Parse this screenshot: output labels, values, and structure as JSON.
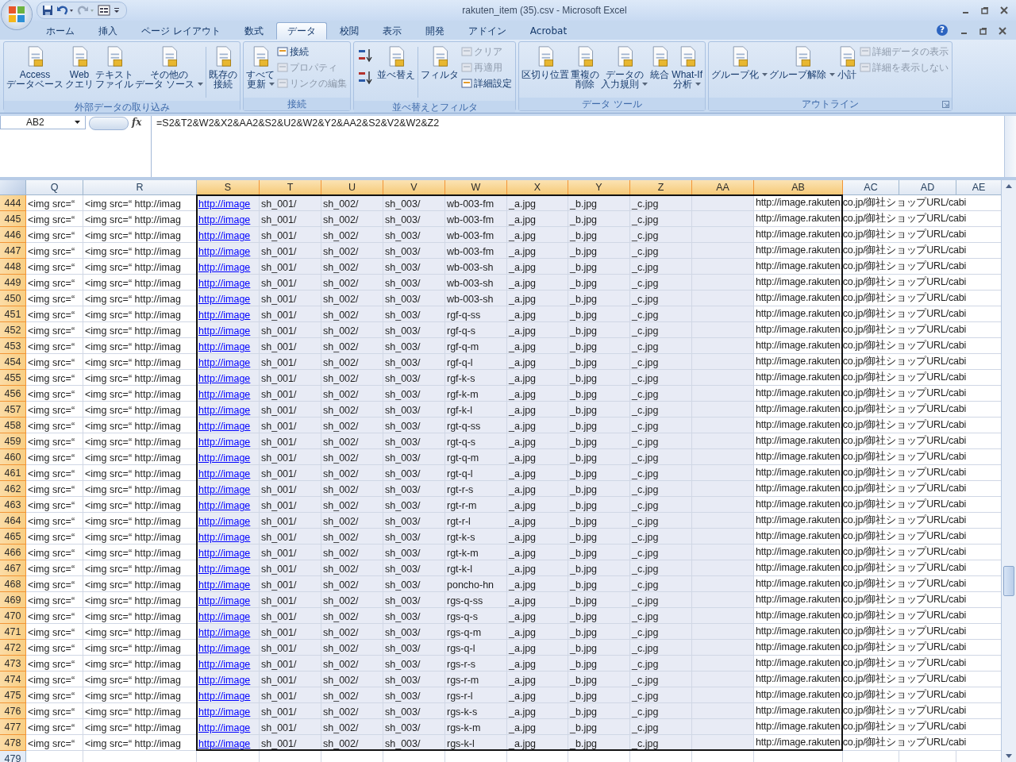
{
  "window": {
    "title": "rakuten_item (35).csv - Microsoft Excel"
  },
  "tabs": [
    {
      "label": "ホーム",
      "selected": false
    },
    {
      "label": "挿入",
      "selected": false
    },
    {
      "label": "ページ レイアウト",
      "selected": false
    },
    {
      "label": "数式",
      "selected": false
    },
    {
      "label": "データ",
      "selected": true
    },
    {
      "label": "校閲",
      "selected": false
    },
    {
      "label": "表示",
      "selected": false
    },
    {
      "label": "開発",
      "selected": false
    },
    {
      "label": "アドイン",
      "selected": false
    },
    {
      "label": "Acrobat",
      "selected": false
    }
  ],
  "help_label": "?",
  "ribbon": [
    {
      "items": [
        {
          "kind": "large",
          "lines": [
            "Access",
            "データベース"
          ],
          "dropdown": false
        },
        {
          "kind": "large",
          "lines": [
            "Web",
            "クエリ"
          ],
          "dropdown": false
        },
        {
          "kind": "large",
          "lines": [
            "テキスト",
            "ファイル"
          ],
          "dropdown": false
        },
        {
          "kind": "large",
          "lines": [
            "その他の",
            "データ ソース"
          ],
          "dropdown": true
        },
        {
          "kind": "separator"
        },
        {
          "kind": "large",
          "lines": [
            "既存の",
            "接続"
          ],
          "dropdown": false
        }
      ],
      "label": "外部データの取り込み",
      "launcher": false
    },
    {
      "items": [
        {
          "kind": "large",
          "lines": [
            "すべて",
            "更新"
          ],
          "dropdown": true
        },
        {
          "kind": "stack",
          "buttons": [
            {
              "label": "接続",
              "disabled": false
            },
            {
              "label": "プロパティ",
              "disabled": true
            },
            {
              "label": "リンクの編集",
              "disabled": true
            }
          ]
        }
      ],
      "label": "接続",
      "launcher": false
    },
    {
      "items": [
        {
          "kind": "sorts"
        },
        {
          "kind": "large",
          "lines": [
            "並べ替え"
          ],
          "dropdown": false
        },
        {
          "kind": "separator"
        },
        {
          "kind": "large",
          "lines": [
            "フィルタ"
          ],
          "dropdown": false
        },
        {
          "kind": "stack",
          "buttons": [
            {
              "label": "クリア",
              "disabled": true
            },
            {
              "label": "再適用",
              "disabled": true
            },
            {
              "label": "詳細設定",
              "disabled": false
            }
          ]
        }
      ],
      "label": "並べ替えとフィルタ",
      "launcher": false
    },
    {
      "items": [
        {
          "kind": "large",
          "lines": [
            "区切り位置"
          ],
          "dropdown": false
        },
        {
          "kind": "large",
          "lines": [
            "重複の",
            "削除"
          ],
          "dropdown": false
        },
        {
          "kind": "large",
          "lines": [
            "データの",
            "入力規則"
          ],
          "dropdown": true
        },
        {
          "kind": "large",
          "lines": [
            "統合"
          ],
          "dropdown": false
        },
        {
          "kind": "large",
          "lines": [
            "What-If",
            "分析"
          ],
          "dropdown": true
        }
      ],
      "label": "データ ツール",
      "launcher": false
    },
    {
      "items": [
        {
          "kind": "large",
          "lines": [
            "グループ化"
          ],
          "dropdown": true
        },
        {
          "kind": "large",
          "lines": [
            "グループ解除"
          ],
          "dropdown": true
        },
        {
          "kind": "large",
          "lines": [
            "小計"
          ],
          "dropdown": false
        },
        {
          "kind": "stack",
          "buttons": [
            {
              "label": "詳細データの表示",
              "disabled": true
            },
            {
              "label": "詳細を表示しない",
              "disabled": true
            }
          ]
        }
      ],
      "label": "アウトライン",
      "launcher": true
    }
  ],
  "name_box": "AB2",
  "function_label": "fx",
  "formula": "=S2&T2&W2&X2&AA2&S2&U2&W2&Y2&AA2&S2&V2&W2&Z2",
  "columns": [
    {
      "letter": "Q",
      "selected": false
    },
    {
      "letter": "R",
      "selected": false
    },
    {
      "letter": "S",
      "selected": true
    },
    {
      "letter": "T",
      "selected": true
    },
    {
      "letter": "U",
      "selected": true
    },
    {
      "letter": "V",
      "selected": true
    },
    {
      "letter": "W",
      "selected": true
    },
    {
      "letter": "X",
      "selected": true
    },
    {
      "letter": "Y",
      "selected": true
    },
    {
      "letter": "Z",
      "selected": true
    },
    {
      "letter": "AA",
      "selected": true
    },
    {
      "letter": "AB",
      "selected": true
    },
    {
      "letter": "AC",
      "selected": false
    },
    {
      "letter": "AD",
      "selected": false
    },
    {
      "letter": "AE",
      "selected": false
    }
  ],
  "rows": [
    {
      "number": "444",
      "selected": true,
      "cells": {
        "Q": "<img src=“",
        "R": "<img src=“ http://imag",
        "S": {
          "text": "http://image",
          "link": true
        },
        "T": "sh_001/",
        "U": "sh_002/",
        "V": "sh_003/",
        "W": "wb-003-fm",
        "X": "_a.jpg",
        "Y": "_b.jpg",
        "Z": "_c.jpg",
        "AB": "http://image.rakuten.co.jp/御社ショップURL/cabi"
      }
    },
    {
      "number": "445",
      "selected": true,
      "cells": {
        "Q": "<img src=“",
        "R": "<img src=“ http://imag",
        "S": {
          "text": "http://image",
          "link": true
        },
        "T": "sh_001/",
        "U": "sh_002/",
        "V": "sh_003/",
        "W": "wb-003-fm",
        "X": "_a.jpg",
        "Y": "_b.jpg",
        "Z": "_c.jpg",
        "AB": "http://image.rakuten.co.jp/御社ショップURL/cabi"
      }
    },
    {
      "number": "446",
      "selected": true,
      "cells": {
        "Q": "<img src=“",
        "R": "<img src=“ http://imag",
        "S": {
          "text": "http://image",
          "link": true
        },
        "T": "sh_001/",
        "U": "sh_002/",
        "V": "sh_003/",
        "W": "wb-003-fm",
        "X": "_a.jpg",
        "Y": "_b.jpg",
        "Z": "_c.jpg",
        "AB": "http://image.rakuten.co.jp/御社ショップURL/cabi"
      }
    },
    {
      "number": "447",
      "selected": true,
      "cells": {
        "Q": "<img src=“",
        "R": "<img src=“ http://imag",
        "S": {
          "text": "http://image",
          "link": true
        },
        "T": "sh_001/",
        "U": "sh_002/",
        "V": "sh_003/",
        "W": "wb-003-fm",
        "X": "_a.jpg",
        "Y": "_b.jpg",
        "Z": "_c.jpg",
        "AB": "http://image.rakuten.co.jp/御社ショップURL/cabi"
      }
    },
    {
      "number": "448",
      "selected": true,
      "cells": {
        "Q": "<img src=“",
        "R": "<img src=“ http://imag",
        "S": {
          "text": "http://image",
          "link": true
        },
        "T": "sh_001/",
        "U": "sh_002/",
        "V": "sh_003/",
        "W": "wb-003-sh",
        "X": "_a.jpg",
        "Y": "_b.jpg",
        "Z": "_c.jpg",
        "AB": "http://image.rakuten.co.jp/御社ショップURL/cabi"
      }
    },
    {
      "number": "449",
      "selected": true,
      "cells": {
        "Q": "<img src=“",
        "R": "<img src=“ http://imag",
        "S": {
          "text": "http://image",
          "link": true
        },
        "T": "sh_001/",
        "U": "sh_002/",
        "V": "sh_003/",
        "W": "wb-003-sh",
        "X": "_a.jpg",
        "Y": "_b.jpg",
        "Z": "_c.jpg",
        "AB": "http://image.rakuten.co.jp/御社ショップURL/cabi"
      }
    },
    {
      "number": "450",
      "selected": true,
      "cells": {
        "Q": "<img src=“",
        "R": "<img src=“ http://imag",
        "S": {
          "text": "http://image",
          "link": true
        },
        "T": "sh_001/",
        "U": "sh_002/",
        "V": "sh_003/",
        "W": "wb-003-sh",
        "X": "_a.jpg",
        "Y": "_b.jpg",
        "Z": "_c.jpg",
        "AB": "http://image.rakuten.co.jp/御社ショップURL/cabi"
      }
    },
    {
      "number": "451",
      "selected": true,
      "cells": {
        "Q": "<img src=“",
        "R": "<img src=“ http://imag",
        "S": {
          "text": "http://image",
          "link": true
        },
        "T": "sh_001/",
        "U": "sh_002/",
        "V": "sh_003/",
        "W": "rgf-q-ss",
        "X": "_a.jpg",
        "Y": "_b.jpg",
        "Z": "_c.jpg",
        "AB": "http://image.rakuten.co.jp/御社ショップURL/cabi"
      }
    },
    {
      "number": "452",
      "selected": true,
      "cells": {
        "Q": "<img src=“",
        "R": "<img src=“ http://imag",
        "S": {
          "text": "http://image",
          "link": true
        },
        "T": "sh_001/",
        "U": "sh_002/",
        "V": "sh_003/",
        "W": "rgf-q-s",
        "X": "_a.jpg",
        "Y": "_b.jpg",
        "Z": "_c.jpg",
        "AB": "http://image.rakuten.co.jp/御社ショップURL/cabi"
      }
    },
    {
      "number": "453",
      "selected": true,
      "cells": {
        "Q": "<img src=“",
        "R": "<img src=“ http://imag",
        "S": {
          "text": "http://image",
          "link": true
        },
        "T": "sh_001/",
        "U": "sh_002/",
        "V": "sh_003/",
        "W": "rgf-q-m",
        "X": "_a.jpg",
        "Y": "_b.jpg",
        "Z": "_c.jpg",
        "AB": "http://image.rakuten.co.jp/御社ショップURL/cabi"
      }
    },
    {
      "number": "454",
      "selected": true,
      "cells": {
        "Q": "<img src=“",
        "R": "<img src=“ http://imag",
        "S": {
          "text": "http://image",
          "link": true
        },
        "T": "sh_001/",
        "U": "sh_002/",
        "V": "sh_003/",
        "W": "rgf-q-l",
        "X": "_a.jpg",
        "Y": "_b.jpg",
        "Z": "_c.jpg",
        "AB": "http://image.rakuten.co.jp/御社ショップURL/cabi"
      }
    },
    {
      "number": "455",
      "selected": true,
      "cells": {
        "Q": "<img src=“",
        "R": "<img src=“ http://imag",
        "S": {
          "text": "http://image",
          "link": true
        },
        "T": "sh_001/",
        "U": "sh_002/",
        "V": "sh_003/",
        "W": "rgf-k-s",
        "X": "_a.jpg",
        "Y": "_b.jpg",
        "Z": "_c.jpg",
        "AB": "http://image.rakuten.co.jp/御社ショップURL/cabi"
      }
    },
    {
      "number": "456",
      "selected": true,
      "cells": {
        "Q": "<img src=“",
        "R": "<img src=“ http://imag",
        "S": {
          "text": "http://image",
          "link": true
        },
        "T": "sh_001/",
        "U": "sh_002/",
        "V": "sh_003/",
        "W": "rgf-k-m",
        "X": "_a.jpg",
        "Y": "_b.jpg",
        "Z": "_c.jpg",
        "AB": "http://image.rakuten.co.jp/御社ショップURL/cabi"
      }
    },
    {
      "number": "457",
      "selected": true,
      "cells": {
        "Q": "<img src=“",
        "R": "<img src=“ http://imag",
        "S": {
          "text": "http://image",
          "link": true
        },
        "T": "sh_001/",
        "U": "sh_002/",
        "V": "sh_003/",
        "W": "rgf-k-l",
        "X": "_a.jpg",
        "Y": "_b.jpg",
        "Z": "_c.jpg",
        "AB": "http://image.rakuten.co.jp/御社ショップURL/cabi"
      }
    },
    {
      "number": "458",
      "selected": true,
      "cells": {
        "Q": "<img src=“",
        "R": "<img src=“ http://imag",
        "S": {
          "text": "http://image",
          "link": true
        },
        "T": "sh_001/",
        "U": "sh_002/",
        "V": "sh_003/",
        "W": "rgt-q-ss",
        "X": "_a.jpg",
        "Y": "_b.jpg",
        "Z": "_c.jpg",
        "AB": "http://image.rakuten.co.jp/御社ショップURL/cabi"
      }
    },
    {
      "number": "459",
      "selected": true,
      "cells": {
        "Q": "<img src=“",
        "R": "<img src=“ http://imag",
        "S": {
          "text": "http://image",
          "link": true
        },
        "T": "sh_001/",
        "U": "sh_002/",
        "V": "sh_003/",
        "W": "rgt-q-s",
        "X": "_a.jpg",
        "Y": "_b.jpg",
        "Z": "_c.jpg",
        "AB": "http://image.rakuten.co.jp/御社ショップURL/cabi"
      }
    },
    {
      "number": "460",
      "selected": true,
      "cells": {
        "Q": "<img src=“",
        "R": "<img src=“ http://imag",
        "S": {
          "text": "http://image",
          "link": true
        },
        "T": "sh_001/",
        "U": "sh_002/",
        "V": "sh_003/",
        "W": "rgt-q-m",
        "X": "_a.jpg",
        "Y": "_b.jpg",
        "Z": "_c.jpg",
        "AB": "http://image.rakuten.co.jp/御社ショップURL/cabi"
      }
    },
    {
      "number": "461",
      "selected": true,
      "cells": {
        "Q": "<img src=“",
        "R": "<img src=“ http://imag",
        "S": {
          "text": "http://image",
          "link": true
        },
        "T": "sh_001/",
        "U": "sh_002/",
        "V": "sh_003/",
        "W": "rgt-q-l",
        "X": "_a.jpg",
        "Y": "_b.jpg",
        "Z": "_c.jpg",
        "AB": "http://image.rakuten.co.jp/御社ショップURL/cabi"
      }
    },
    {
      "number": "462",
      "selected": true,
      "cells": {
        "Q": "<img src=“",
        "R": "<img src=“ http://imag",
        "S": {
          "text": "http://image",
          "link": true
        },
        "T": "sh_001/",
        "U": "sh_002/",
        "V": "sh_003/",
        "W": "rgt-r-s",
        "X": "_a.jpg",
        "Y": "_b.jpg",
        "Z": "_c.jpg",
        "AB": "http://image.rakuten.co.jp/御社ショップURL/cabi"
      }
    },
    {
      "number": "463",
      "selected": true,
      "cells": {
        "Q": "<img src=“",
        "R": "<img src=“ http://imag",
        "S": {
          "text": "http://image",
          "link": true
        },
        "T": "sh_001/",
        "U": "sh_002/",
        "V": "sh_003/",
        "W": "rgt-r-m",
        "X": "_a.jpg",
        "Y": "_b.jpg",
        "Z": "_c.jpg",
        "AB": "http://image.rakuten.co.jp/御社ショップURL/cabi"
      }
    },
    {
      "number": "464",
      "selected": true,
      "cells": {
        "Q": "<img src=“",
        "R": "<img src=“ http://imag",
        "S": {
          "text": "http://image",
          "link": true
        },
        "T": "sh_001/",
        "U": "sh_002/",
        "V": "sh_003/",
        "W": "rgt-r-l",
        "X": "_a.jpg",
        "Y": "_b.jpg",
        "Z": "_c.jpg",
        "AB": "http://image.rakuten.co.jp/御社ショップURL/cabi"
      }
    },
    {
      "number": "465",
      "selected": true,
      "cells": {
        "Q": "<img src=“",
        "R": "<img src=“ http://imag",
        "S": {
          "text": "http://image",
          "link": true
        },
        "T": "sh_001/",
        "U": "sh_002/",
        "V": "sh_003/",
        "W": "rgt-k-s",
        "X": "_a.jpg",
        "Y": "_b.jpg",
        "Z": "_c.jpg",
        "AB": "http://image.rakuten.co.jp/御社ショップURL/cabi"
      }
    },
    {
      "number": "466",
      "selected": true,
      "cells": {
        "Q": "<img src=“",
        "R": "<img src=“ http://imag",
        "S": {
          "text": "http://image",
          "link": true
        },
        "T": "sh_001/",
        "U": "sh_002/",
        "V": "sh_003/",
        "W": "rgt-k-m",
        "X": "_a.jpg",
        "Y": "_b.jpg",
        "Z": "_c.jpg",
        "AB": "http://image.rakuten.co.jp/御社ショップURL/cabi"
      }
    },
    {
      "number": "467",
      "selected": true,
      "cells": {
        "Q": "<img src=“",
        "R": "<img src=“ http://imag",
        "S": {
          "text": "http://image",
          "link": true
        },
        "T": "sh_001/",
        "U": "sh_002/",
        "V": "sh_003/",
        "W": "rgt-k-l",
        "X": "_a.jpg",
        "Y": "_b.jpg",
        "Z": "_c.jpg",
        "AB": "http://image.rakuten.co.jp/御社ショップURL/cabi"
      }
    },
    {
      "number": "468",
      "selected": true,
      "cells": {
        "Q": "<img src=“",
        "R": "<img src=“ http://imag",
        "S": {
          "text": "http://image",
          "link": true
        },
        "T": "sh_001/",
        "U": "sh_002/",
        "V": "sh_003/",
        "W": "poncho-hn",
        "X": "_a.jpg",
        "Y": "_b.jpg",
        "Z": "_c.jpg",
        "AB": "http://image.rakuten.co.jp/御社ショップURL/cabi"
      }
    },
    {
      "number": "469",
      "selected": true,
      "cells": {
        "Q": "<img src=“",
        "R": "<img src=“ http://imag",
        "S": {
          "text": "http://image",
          "link": true
        },
        "T": "sh_001/",
        "U": "sh_002/",
        "V": "sh_003/",
        "W": "rgs-q-ss",
        "X": "_a.jpg",
        "Y": "_b.jpg",
        "Z": "_c.jpg",
        "AB": "http://image.rakuten.co.jp/御社ショップURL/cabi"
      }
    },
    {
      "number": "470",
      "selected": true,
      "cells": {
        "Q": "<img src=“",
        "R": "<img src=“ http://imag",
        "S": {
          "text": "http://image",
          "link": true
        },
        "T": "sh_001/",
        "U": "sh_002/",
        "V": "sh_003/",
        "W": "rgs-q-s",
        "X": "_a.jpg",
        "Y": "_b.jpg",
        "Z": "_c.jpg",
        "AB": "http://image.rakuten.co.jp/御社ショップURL/cabi"
      }
    },
    {
      "number": "471",
      "selected": true,
      "cells": {
        "Q": "<img src=“",
        "R": "<img src=“ http://imag",
        "S": {
          "text": "http://image",
          "link": true
        },
        "T": "sh_001/",
        "U": "sh_002/",
        "V": "sh_003/",
        "W": "rgs-q-m",
        "X": "_a.jpg",
        "Y": "_b.jpg",
        "Z": "_c.jpg",
        "AB": "http://image.rakuten.co.jp/御社ショップURL/cabi"
      }
    },
    {
      "number": "472",
      "selected": true,
      "cells": {
        "Q": "<img src=“",
        "R": "<img src=“ http://imag",
        "S": {
          "text": "http://image",
          "link": true
        },
        "T": "sh_001/",
        "U": "sh_002/",
        "V": "sh_003/",
        "W": "rgs-q-l",
        "X": "_a.jpg",
        "Y": "_b.jpg",
        "Z": "_c.jpg",
        "AB": "http://image.rakuten.co.jp/御社ショップURL/cabi"
      }
    },
    {
      "number": "473",
      "selected": true,
      "cells": {
        "Q": "<img src=“",
        "R": "<img src=“ http://imag",
        "S": {
          "text": "http://image",
          "link": true
        },
        "T": "sh_001/",
        "U": "sh_002/",
        "V": "sh_003/",
        "W": "rgs-r-s",
        "X": "_a.jpg",
        "Y": "_b.jpg",
        "Z": "_c.jpg",
        "AB": "http://image.rakuten.co.jp/御社ショップURL/cabi"
      }
    },
    {
      "number": "474",
      "selected": true,
      "cells": {
        "Q": "<img src=“",
        "R": "<img src=“ http://imag",
        "S": {
          "text": "http://image",
          "link": true
        },
        "T": "sh_001/",
        "U": "sh_002/",
        "V": "sh_003/",
        "W": "rgs-r-m",
        "X": "_a.jpg",
        "Y": "_b.jpg",
        "Z": "_c.jpg",
        "AB": "http://image.rakuten.co.jp/御社ショップURL/cabi"
      }
    },
    {
      "number": "475",
      "selected": true,
      "cells": {
        "Q": "<img src=“",
        "R": "<img src=“ http://imag",
        "S": {
          "text": "http://image",
          "link": true
        },
        "T": "sh_001/",
        "U": "sh_002/",
        "V": "sh_003/",
        "W": "rgs-r-l",
        "X": "_a.jpg",
        "Y": "_b.jpg",
        "Z": "_c.jpg",
        "AB": "http://image.rakuten.co.jp/御社ショップURL/cabi"
      }
    },
    {
      "number": "476",
      "selected": true,
      "cells": {
        "Q": "<img src=“",
        "R": "<img src=“ http://imag",
        "S": {
          "text": "http://image",
          "link": true
        },
        "T": "sh_001/",
        "U": "sh_002/",
        "V": "sh_003/",
        "W": "rgs-k-s",
        "X": "_a.jpg",
        "Y": "_b.jpg",
        "Z": "_c.jpg",
        "AB": "http://image.rakuten.co.jp/御社ショップURL/cabi"
      }
    },
    {
      "number": "477",
      "selected": true,
      "cells": {
        "Q": "<img src=“",
        "R": "<img src=“ http://imag",
        "S": {
          "text": "http://image",
          "link": true
        },
        "T": "sh_001/",
        "U": "sh_002/",
        "V": "sh_003/",
        "W": "rgs-k-m",
        "X": "_a.jpg",
        "Y": "_b.jpg",
        "Z": "_c.jpg",
        "AB": "http://image.rakuten.co.jp/御社ショップURL/cabi"
      }
    },
    {
      "number": "478",
      "selected": true,
      "cells": {
        "Q": "<img src=“",
        "R": "<img src=“ http://imag",
        "S": {
          "text": "http://image",
          "link": true
        },
        "T": "sh_001/",
        "U": "sh_002/",
        "V": "sh_003/",
        "W": "rgs-k-l",
        "X": "_a.jpg",
        "Y": "_b.jpg",
        "Z": "_c.jpg",
        "AB": "http://image.rakuten.co.jp/御社ショップURL/cabi"
      }
    },
    {
      "number": "479",
      "selected": false,
      "cells": {}
    }
  ]
}
